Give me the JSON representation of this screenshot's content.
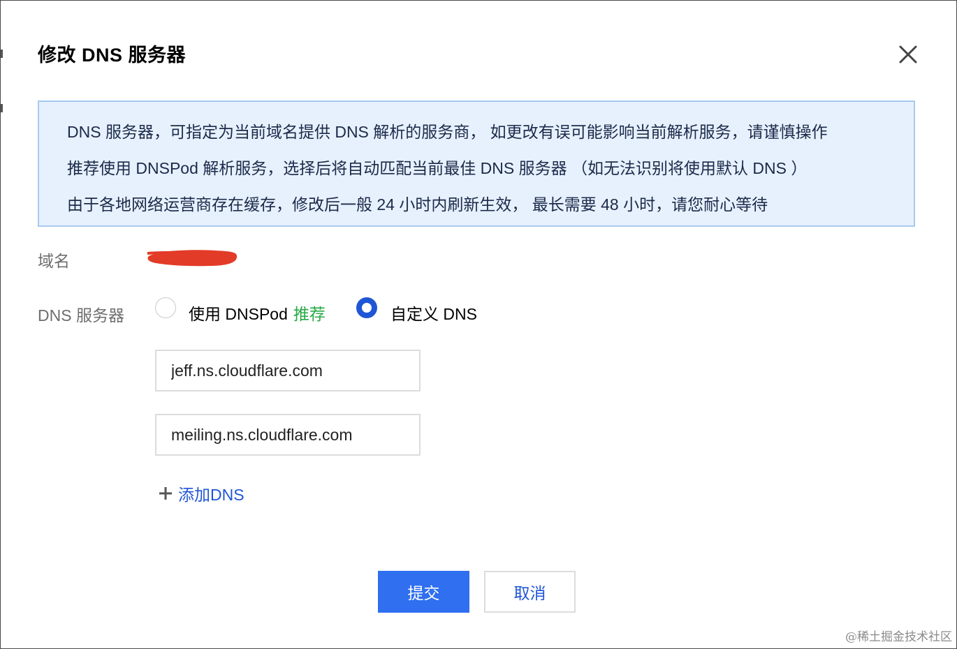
{
  "dialog": {
    "title": "修改 DNS 服务器"
  },
  "notice": {
    "lines": [
      "DNS 服务器，可指定为当前域名提供 DNS 解析的服务商， 如更改有误可能影响当前解析服务，请谨慎操作",
      "推荐使用 DNSPod 解析服务，选择后将自动匹配当前最佳 DNS 服务器 （如无法识别将使用默认 DNS ）",
      "由于各地网络运营商存在缓存，修改后一般 24 小时内刷新生效， 最长需要 48 小时，请您耐心等待"
    ]
  },
  "form": {
    "domain_label": "域名",
    "dns_label": "DNS 服务器",
    "option_dnspod": "使用 DNSPod",
    "option_dnspod_tag": "推荐",
    "option_custom": "自定义 DNS",
    "selected_option": "custom",
    "dns_servers": [
      "jeff.ns.cloudflare.com",
      "meiling.ns.cloudflare.com"
    ],
    "add_dns_label": "添加DNS"
  },
  "buttons": {
    "submit": "提交",
    "cancel": "取消"
  },
  "watermark": "@稀土掘金技术社区",
  "colors": {
    "primary": "#2f6ff0",
    "link": "#1f56d6",
    "recommend": "#27a844",
    "notice_bg": "#e7f1fd",
    "notice_border": "#a7c9f0",
    "redaction": "#e23b27"
  },
  "icons": {
    "close": "close-icon",
    "add": "plus-icon"
  }
}
